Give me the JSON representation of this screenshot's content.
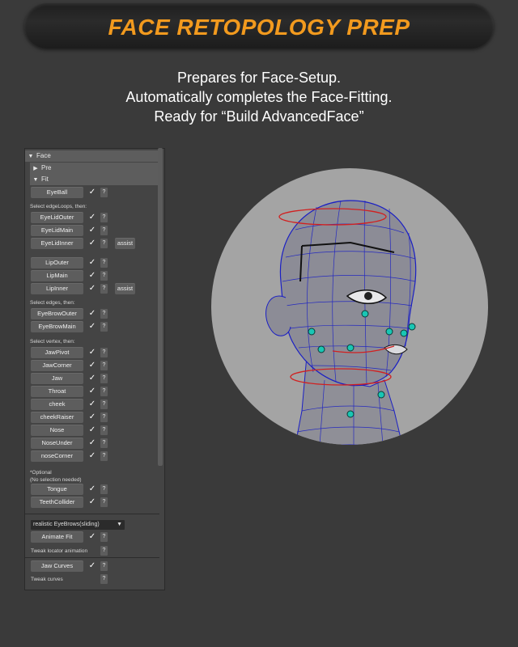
{
  "header": {
    "title": "FACE RETOPOLOGY PREP"
  },
  "description": {
    "line1": "Prepares for Face-Setup.",
    "line2": "Automatically completes the Face-Fitting.",
    "line3": "Ready for “Build AdvancedFace”"
  },
  "panel": {
    "face_label": "Face",
    "pre_label": "Pre",
    "fit_label": "Fit",
    "check_glyph": "✓",
    "help_glyph": "?",
    "assist_label": "assist",
    "eyeball": "EyeBall",
    "edgeloops_label": "Select edgeLoops, then:",
    "eyelid_outer": "EyeLidOuter",
    "eyelid_main": "EyeLidMain",
    "eyelid_inner": "EyeLidInner",
    "lip_outer": "LipOuter",
    "lip_main": "LipMain",
    "lip_inner": "LipInner",
    "edges_label": "Select edges, then:",
    "eyebrow_outer": "EyeBrowOuter",
    "eyebrow_main": "EyeBrowMain",
    "vertex_label": "Select vertex, then:",
    "jaw_pivot": "JawPivot",
    "jaw_corner": "JawCorner",
    "jaw": "Jaw",
    "throat": "Throat",
    "cheek": "cheek",
    "cheek_raiser": "cheekRaiser",
    "nose": "Nose",
    "nose_under": "NoseUnder",
    "nose_corner": "noseCorner",
    "optional_label": "*Optional",
    "no_selection_label": "(No selection needed)",
    "tongue": "Tongue",
    "teeth_collider": "TeethCollider",
    "eyebrows_option": "realistic EyeBrows(sliding)",
    "animate_fit": "Animate Fit",
    "tweak_locator": "Tweak locator animation",
    "jaw_curves": "Jaw Curves",
    "tweak_curves": "Tweak curves"
  },
  "colors": {
    "title": "#f29a1e",
    "background": "#3a3a3a",
    "panel": "#444444",
    "button": "#5d5d5d",
    "viewport_circle": "#a4a4a4",
    "wire": "#1a1fc4",
    "joint": "#19c6b4",
    "curve": "#d12020"
  }
}
